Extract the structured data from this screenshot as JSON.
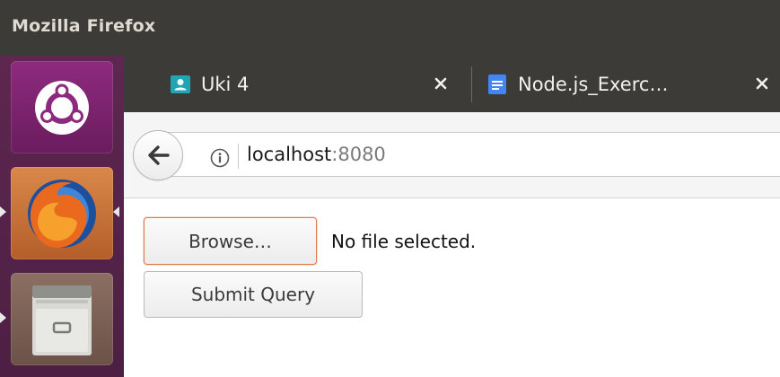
{
  "window": {
    "title": "Mozilla Firefox"
  },
  "launcher": {
    "items": [
      {
        "name": "ubuntu-dash",
        "icon": "ubuntu-logo-icon"
      },
      {
        "name": "firefox",
        "icon": "firefox-icon"
      },
      {
        "name": "files",
        "icon": "file-cabinet-icon"
      }
    ]
  },
  "tabs": [
    {
      "title": "Uki 4",
      "favicon": "contact-icon",
      "favicon_color": "#1fa5b3"
    },
    {
      "title": "Node.js_Exerc…",
      "favicon": "google-docs-icon",
      "favicon_color": "#4285f4"
    }
  ],
  "navbar": {
    "url_host": "localhost",
    "url_port": ":8080"
  },
  "page": {
    "browse_label": "Browse…",
    "file_status": "No file selected.",
    "submit_label": "Submit Query"
  },
  "colors": {
    "chrome_dark": "#3c3b37",
    "launcher_purple": "#5e2750",
    "focus_orange": "#e07b4f"
  }
}
